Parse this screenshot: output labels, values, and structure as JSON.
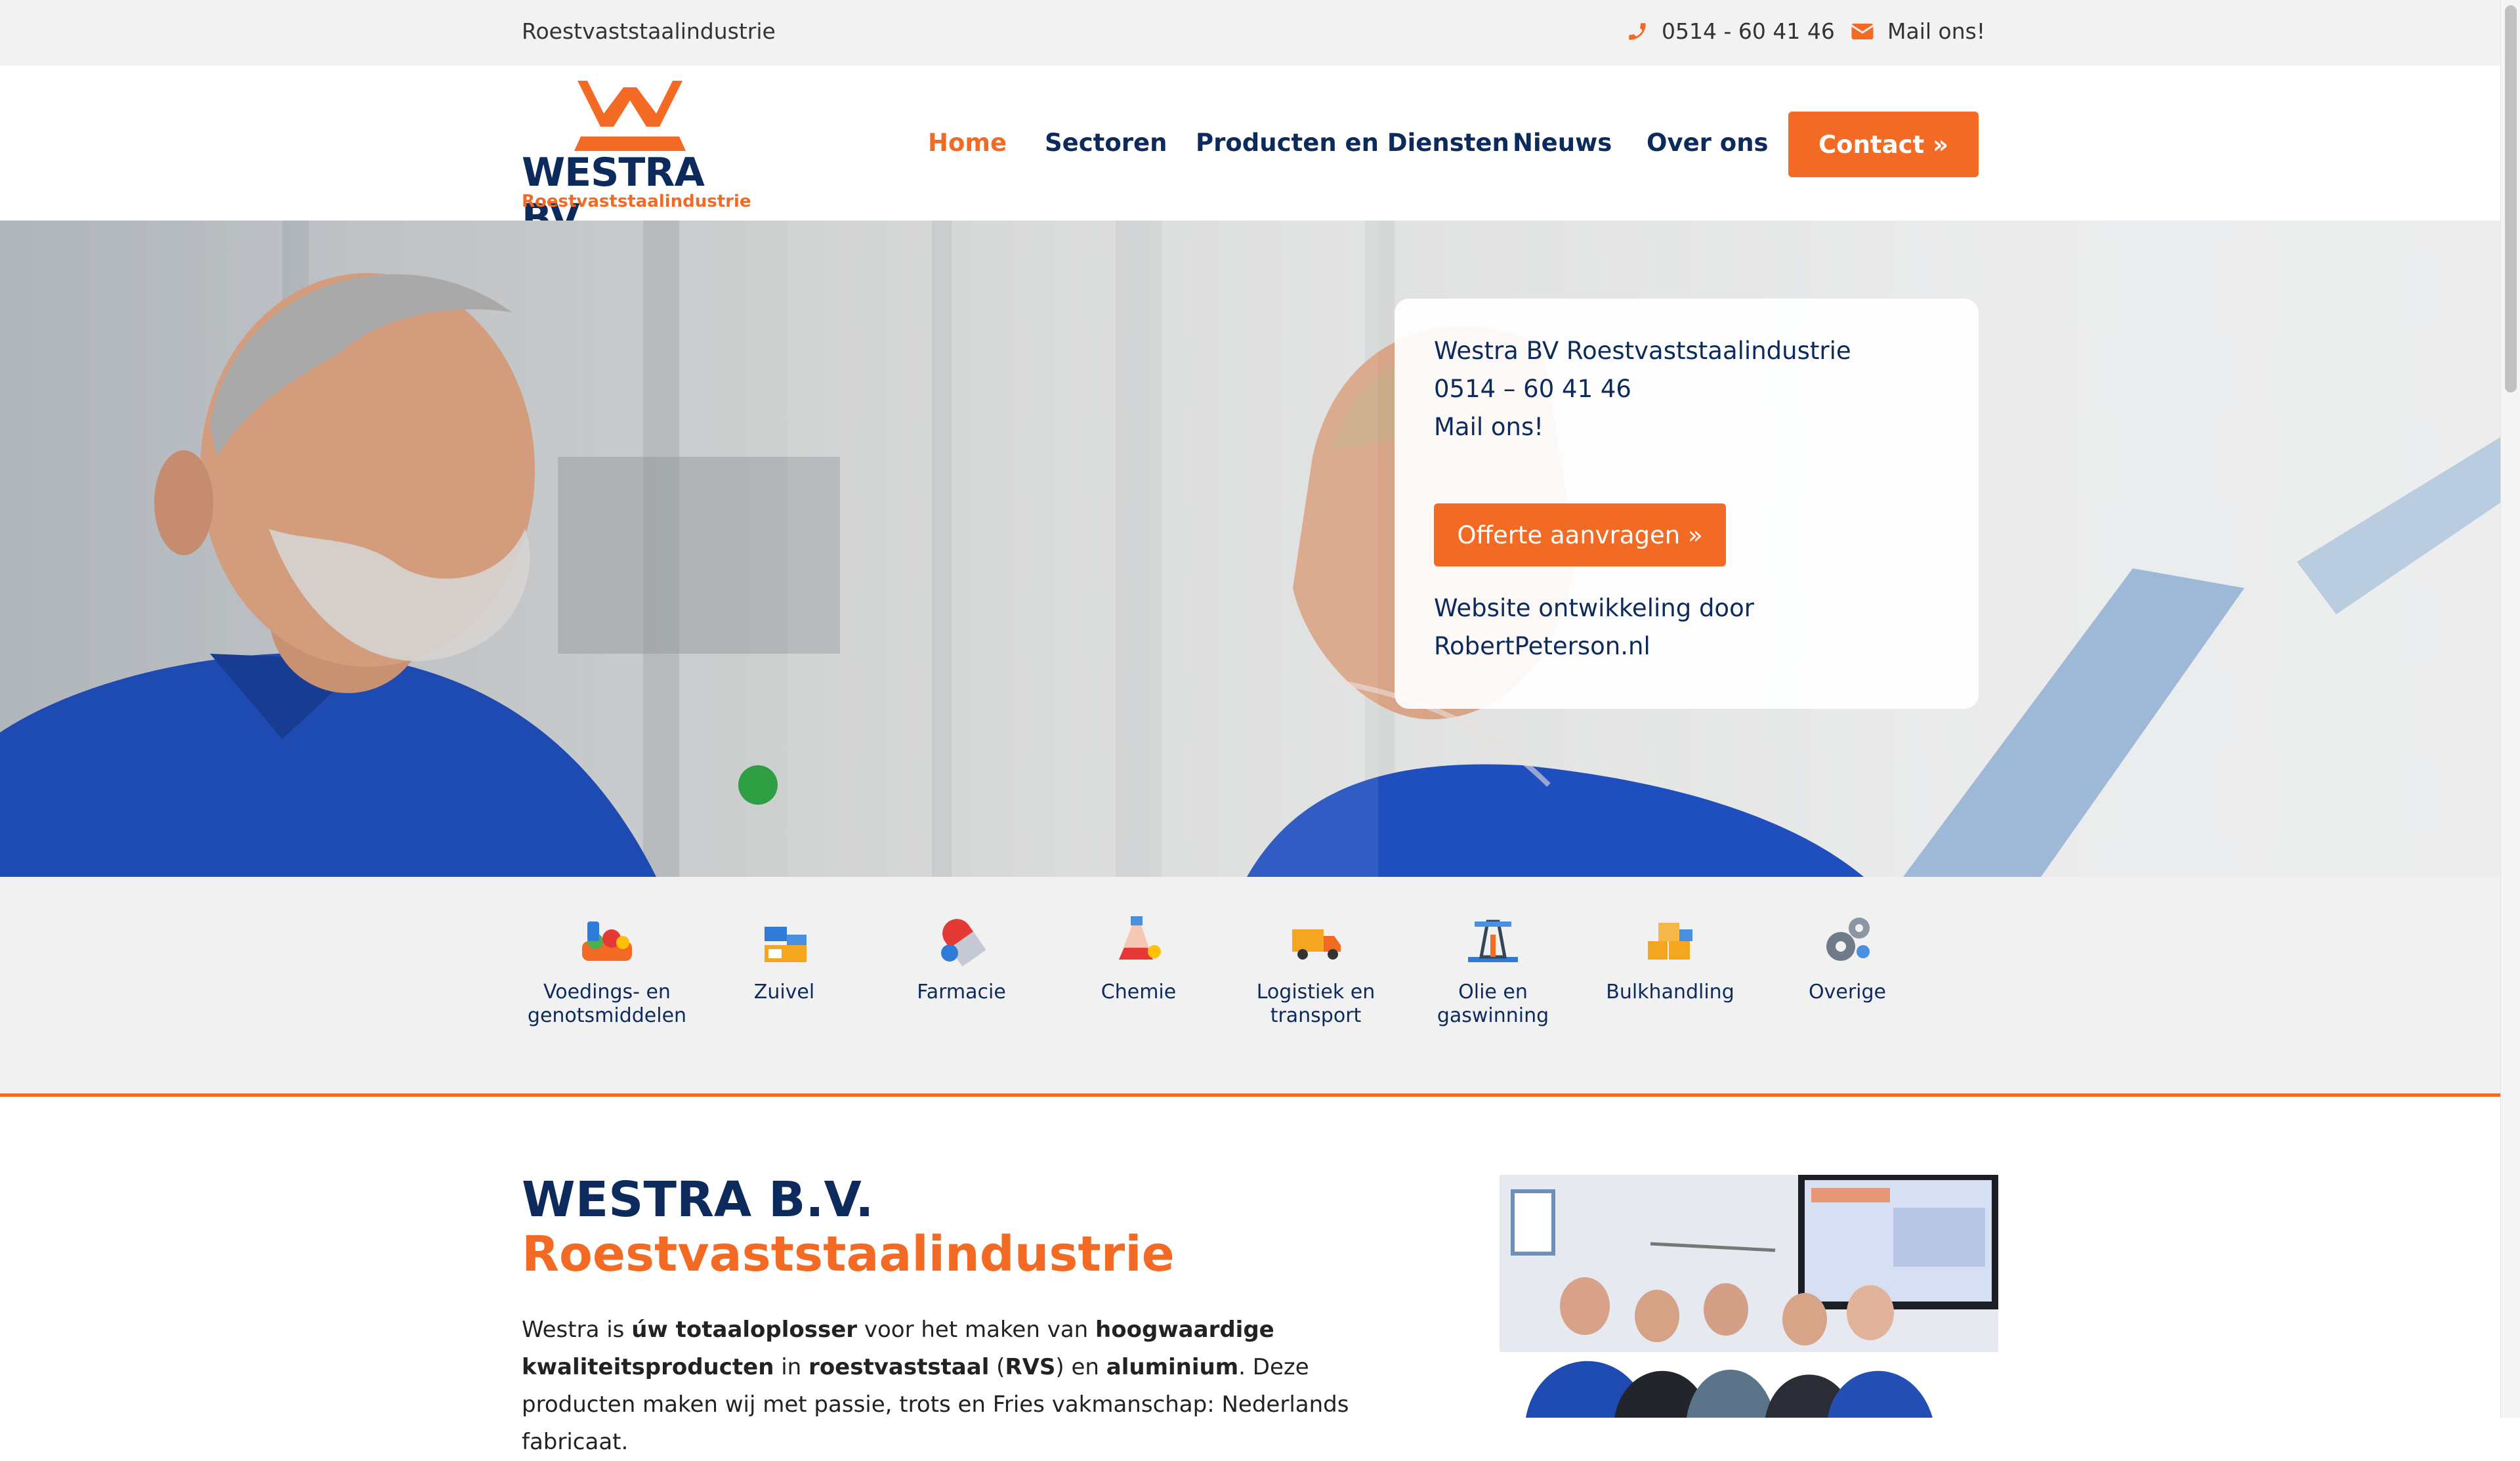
{
  "topbar": {
    "brand": "Roestvaststaalindustrie",
    "phone": "0514 - 60 41 46",
    "mail": "Mail ons!",
    "phone_icon": "phone-icon",
    "mail_icon": "envelope-icon"
  },
  "header": {
    "logo_wordmark": "WESTRA BV",
    "logo_sub": "Roestvaststaalindustrie",
    "nav": [
      "Home",
      "Sectoren",
      "Producten en Diensten",
      "Nieuws",
      "Over ons"
    ],
    "active_nav": "Home",
    "contact_label": "Contact »"
  },
  "hero": {
    "panel_line1": "Westra BV Roestvaststaalindustrie",
    "panel_line2": "0514 – 60 41 46",
    "panel_line3": "Mail ons!",
    "offerte_label": "Offerte aanvragen »",
    "credit_line1": "Website ontwikkeling door",
    "credit_line2": "RobertPeterson.nl"
  },
  "sectors": [
    {
      "label": "Voedings- en genotsmiddelen",
      "icon": "food-icon"
    },
    {
      "label": "Zuivel",
      "icon": "dairy-icon"
    },
    {
      "label": "Farmacie",
      "icon": "pill-icon"
    },
    {
      "label": "Chemie",
      "icon": "flask-icon"
    },
    {
      "label": "Logistiek en transport",
      "icon": "truck-icon"
    },
    {
      "label": "Olie en gaswinning",
      "icon": "oil-rig-icon"
    },
    {
      "label": "Bulkhandling",
      "icon": "crates-icon"
    },
    {
      "label": "Overige",
      "icon": "gears-icon"
    }
  ],
  "content": {
    "title": "WESTRA B.V.",
    "subtitle": "Roestvaststaalindustrie",
    "p_t1": "Westra is ",
    "p_b1": "úw totaaloplosser",
    "p_t2": " voor het maken van ",
    "p_b2": "hoogwaardige kwaliteitsproducten",
    "p_t3": " in ",
    "p_b3": "roestvaststaal",
    "p_t4": " (",
    "p_b4": "RVS",
    "p_t5": ") en ",
    "p_b5": "aluminium",
    "p_t6": ". Deze producten maken wij met passie, trots en Fries vakmanschap: Nederlands fabricaat."
  },
  "colors": {
    "accent": "#f26a24",
    "navy": "#0d2a5c",
    "topbar_bg": "#f2f2f2",
    "sectors_bg": "#f1f1f1"
  }
}
